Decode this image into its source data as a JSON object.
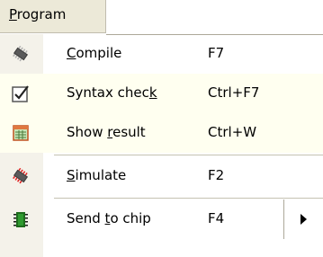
{
  "menubar": {
    "title_prefix": "P",
    "title_rest": "rogram"
  },
  "items": [
    {
      "label_pre": "",
      "label_mnemonic": "C",
      "label_post": "ompile",
      "shortcut": "F7",
      "icon": "chip-compile-icon"
    },
    {
      "label_pre": "Syntax chec",
      "label_mnemonic": "k",
      "label_post": "",
      "shortcut": "Ctrl+F7",
      "icon": "syntax-check-icon"
    },
    {
      "label_pre": "Show ",
      "label_mnemonic": "r",
      "label_post": "esult",
      "shortcut": "Ctrl+W",
      "icon": "show-result-icon"
    },
    {
      "label_pre": "",
      "label_mnemonic": "S",
      "label_post": "imulate",
      "shortcut": "F2",
      "icon": "chip-simulate-icon"
    },
    {
      "label_pre": "Send ",
      "label_mnemonic": "t",
      "label_post": "o chip",
      "shortcut": "F4",
      "icon": "send-to-chip-icon",
      "submenu_icon": "submenu-arrow-icon"
    }
  ]
}
